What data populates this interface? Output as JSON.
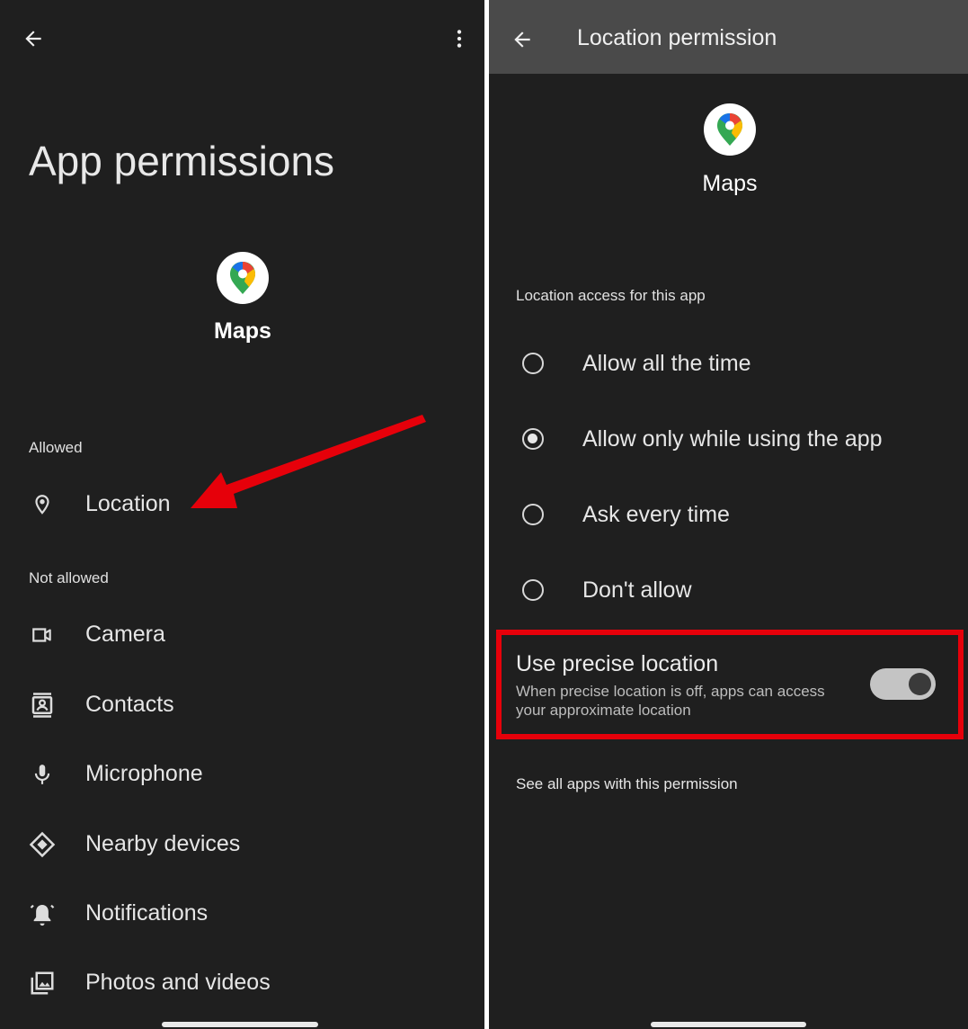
{
  "left": {
    "title": "App permissions",
    "app_name": "Maps",
    "allowed_label": "Allowed",
    "not_allowed_label": "Not allowed",
    "allowed": [
      {
        "label": "Location",
        "icon": "location-pin-icon"
      }
    ],
    "not_allowed": [
      {
        "label": "Camera",
        "icon": "camera-icon"
      },
      {
        "label": "Contacts",
        "icon": "contacts-icon"
      },
      {
        "label": "Microphone",
        "icon": "microphone-icon"
      },
      {
        "label": "Nearby devices",
        "icon": "nearby-devices-icon"
      },
      {
        "label": "Notifications",
        "icon": "notifications-icon"
      },
      {
        "label": "Photos and videos",
        "icon": "photos-icon"
      }
    ]
  },
  "right": {
    "title": "Location permission",
    "app_name": "Maps",
    "section_label": "Location access for this app",
    "options": [
      {
        "label": "Allow all the time",
        "checked": false
      },
      {
        "label": "Allow only while using the app",
        "checked": true
      },
      {
        "label": "Ask every time",
        "checked": false
      },
      {
        "label": "Don't allow",
        "checked": false
      }
    ],
    "precise": {
      "title": "Use precise location",
      "description": "When precise location is off, apps can access your approximate location",
      "enabled": true
    },
    "see_all": "See all apps with this permission"
  },
  "colors": {
    "background": "#1f1f1f",
    "topbar": "#4a4a4a",
    "highlight": "#e6000a"
  }
}
